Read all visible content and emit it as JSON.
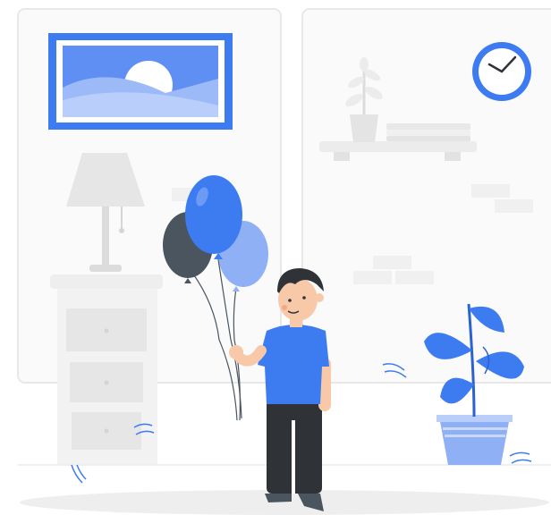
{
  "scene": {
    "description_items": [
      "picture-frame",
      "wall-clock",
      "wall-shelf",
      "potted-plant-small",
      "books",
      "floor-lamp",
      "drawer-cabinet",
      "balloons",
      "boy",
      "potted-plant-large",
      "floor"
    ]
  },
  "colors": {
    "accent": "#3d7bf0",
    "accent_light": "#8fb0f5",
    "accent_pale": "#c9d8fb",
    "wall_line": "#e6e6e6",
    "furniture": "#ececec",
    "furniture_shade": "#dcdcdc",
    "dark": "#2f3338",
    "balloon_dark": "#4a5560",
    "skin": "#f7c9a8"
  },
  "clock": {
    "time_shown": "2:40"
  }
}
